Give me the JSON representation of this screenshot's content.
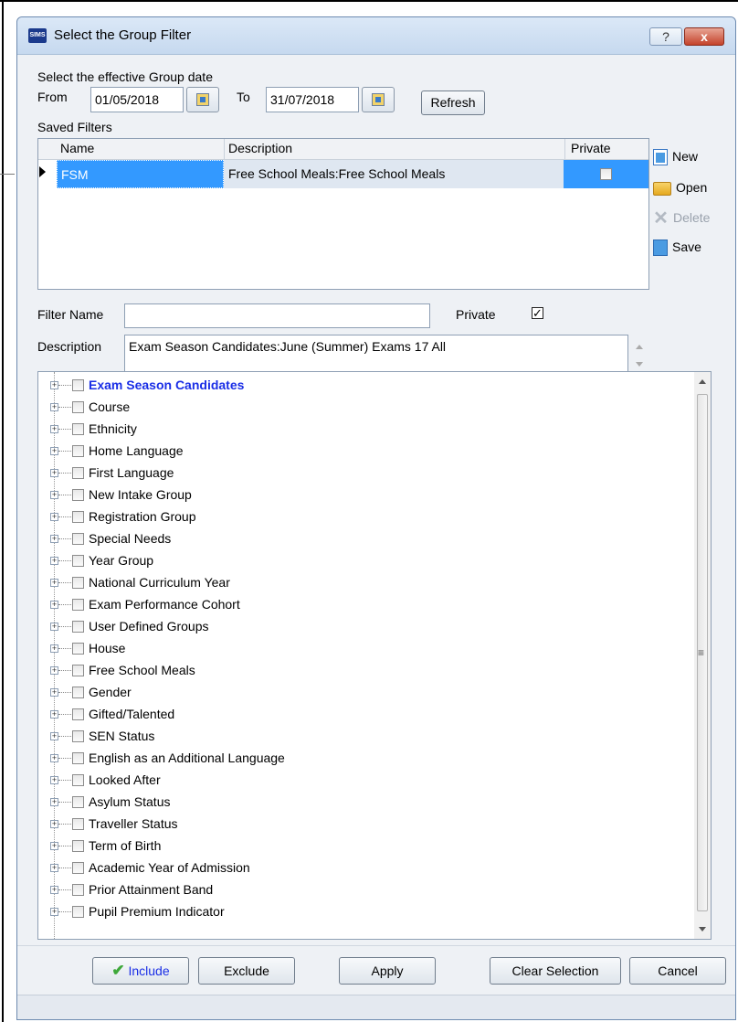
{
  "window": {
    "app_icon": "SIMS",
    "title": "Select the Group Filter",
    "help_label": "?",
    "close_label": "x"
  },
  "date_section": {
    "heading": "Select the effective Group date",
    "from_label": "From",
    "from_value": "01/05/2018",
    "to_label": "To",
    "to_value": "31/07/2018",
    "refresh_label": "Refresh",
    "calendar_icon": "calendar-icon"
  },
  "saved_filters": {
    "heading": "Saved Filters",
    "columns": [
      "Name",
      "Description",
      "Private"
    ],
    "rows": [
      {
        "name": "FSM",
        "description": "Free School Meals:Free School Meals",
        "private": false
      }
    ],
    "actions": {
      "new_label": "New",
      "open_label": "Open",
      "delete_label": "Delete",
      "save_label": "Save"
    }
  },
  "filter": {
    "name_label": "Filter Name",
    "name_value": "",
    "private_label": "Private",
    "private_checked": true,
    "description_label": "Description",
    "description_value": "Exam Season Candidates:June (Summer) Exams 17 All"
  },
  "tree": {
    "items": [
      "Exam Season Candidates",
      "Course",
      "Ethnicity",
      "Home Language",
      "First Language",
      "New Intake Group",
      "Registration Group",
      "Special Needs",
      "Year Group",
      "National Curriculum Year",
      "Exam Performance Cohort",
      "User Defined Groups",
      "House",
      "Free School Meals",
      "Gender",
      "Gifted/Talented",
      "SEN Status",
      "English as an Additional Language",
      "Looked After",
      "Asylum Status",
      "Traveller Status",
      "Term of Birth",
      "Academic Year of Admission",
      "Prior Attainment Band",
      "Pupil Premium Indicator"
    ],
    "highlighted_item_color": "#1a2ee6"
  },
  "buttons": {
    "include_label": "Include",
    "exclude_label": "Exclude",
    "apply_label": "Apply",
    "clear_label": "Clear Selection",
    "cancel_label": "Cancel"
  },
  "colors": {
    "selection": "#3399ff",
    "include_check": "#3ea83a"
  }
}
